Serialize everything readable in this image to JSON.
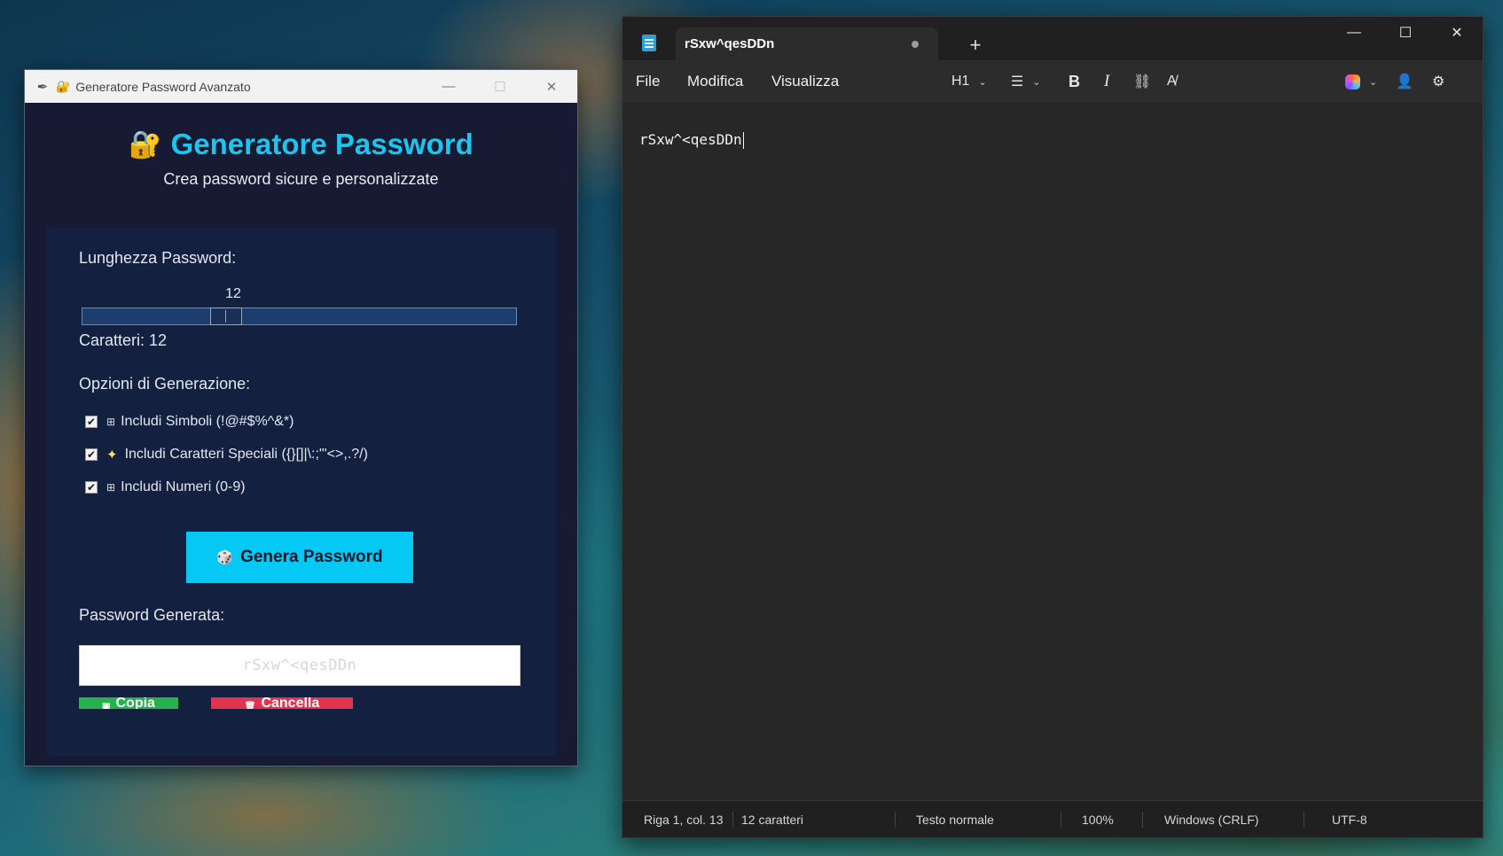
{
  "password_app": {
    "window_title": "Generatore Password Avanzato",
    "heading": "Generatore Password",
    "subtitle": "Crea password sicure e personalizzate",
    "length_label": "Lunghezza Password:",
    "length_value": "12",
    "length_slider": {
      "value": 12
    },
    "char_count_text": "Caratteri: 12",
    "options_label": "Opzioni di Generazione:",
    "options": [
      {
        "label": "Includi Simboli (!@#$%^&*)",
        "checked": true,
        "icon": "symbols-icon"
      },
      {
        "label": "Includi Caratteri Speciali ({}[]|\\:;\"'<>,.?/)",
        "checked": true,
        "icon": "sparkles-icon"
      },
      {
        "label": "Includi Numeri (0-9)",
        "checked": true,
        "icon": "numbers-icon"
      }
    ],
    "generate_button": "Genera Password",
    "generated_label": "Password Generata:",
    "generated_password": "rSxw^<qesDDn",
    "copy_button": "Copia",
    "clear_button": "Cancella",
    "colors": {
      "accent": "#19c6ef",
      "generate": "#05c8f5",
      "copy": "#27b04b",
      "clear": "#e2334f"
    }
  },
  "notepad": {
    "tab_title": "rSxw^qesDDn",
    "unsaved_indicator": "●",
    "menus": [
      "File",
      "Modifica",
      "Visualizza"
    ],
    "heading_dropdown": "H1",
    "content": "rSxw^<qesDDn",
    "status": {
      "position": "Riga 1, col. 13",
      "chars": "12 caratteri",
      "format": "Testo normale",
      "zoom": "100%",
      "line_ending": "Windows (CRLF)",
      "encoding": "UTF-8"
    }
  }
}
